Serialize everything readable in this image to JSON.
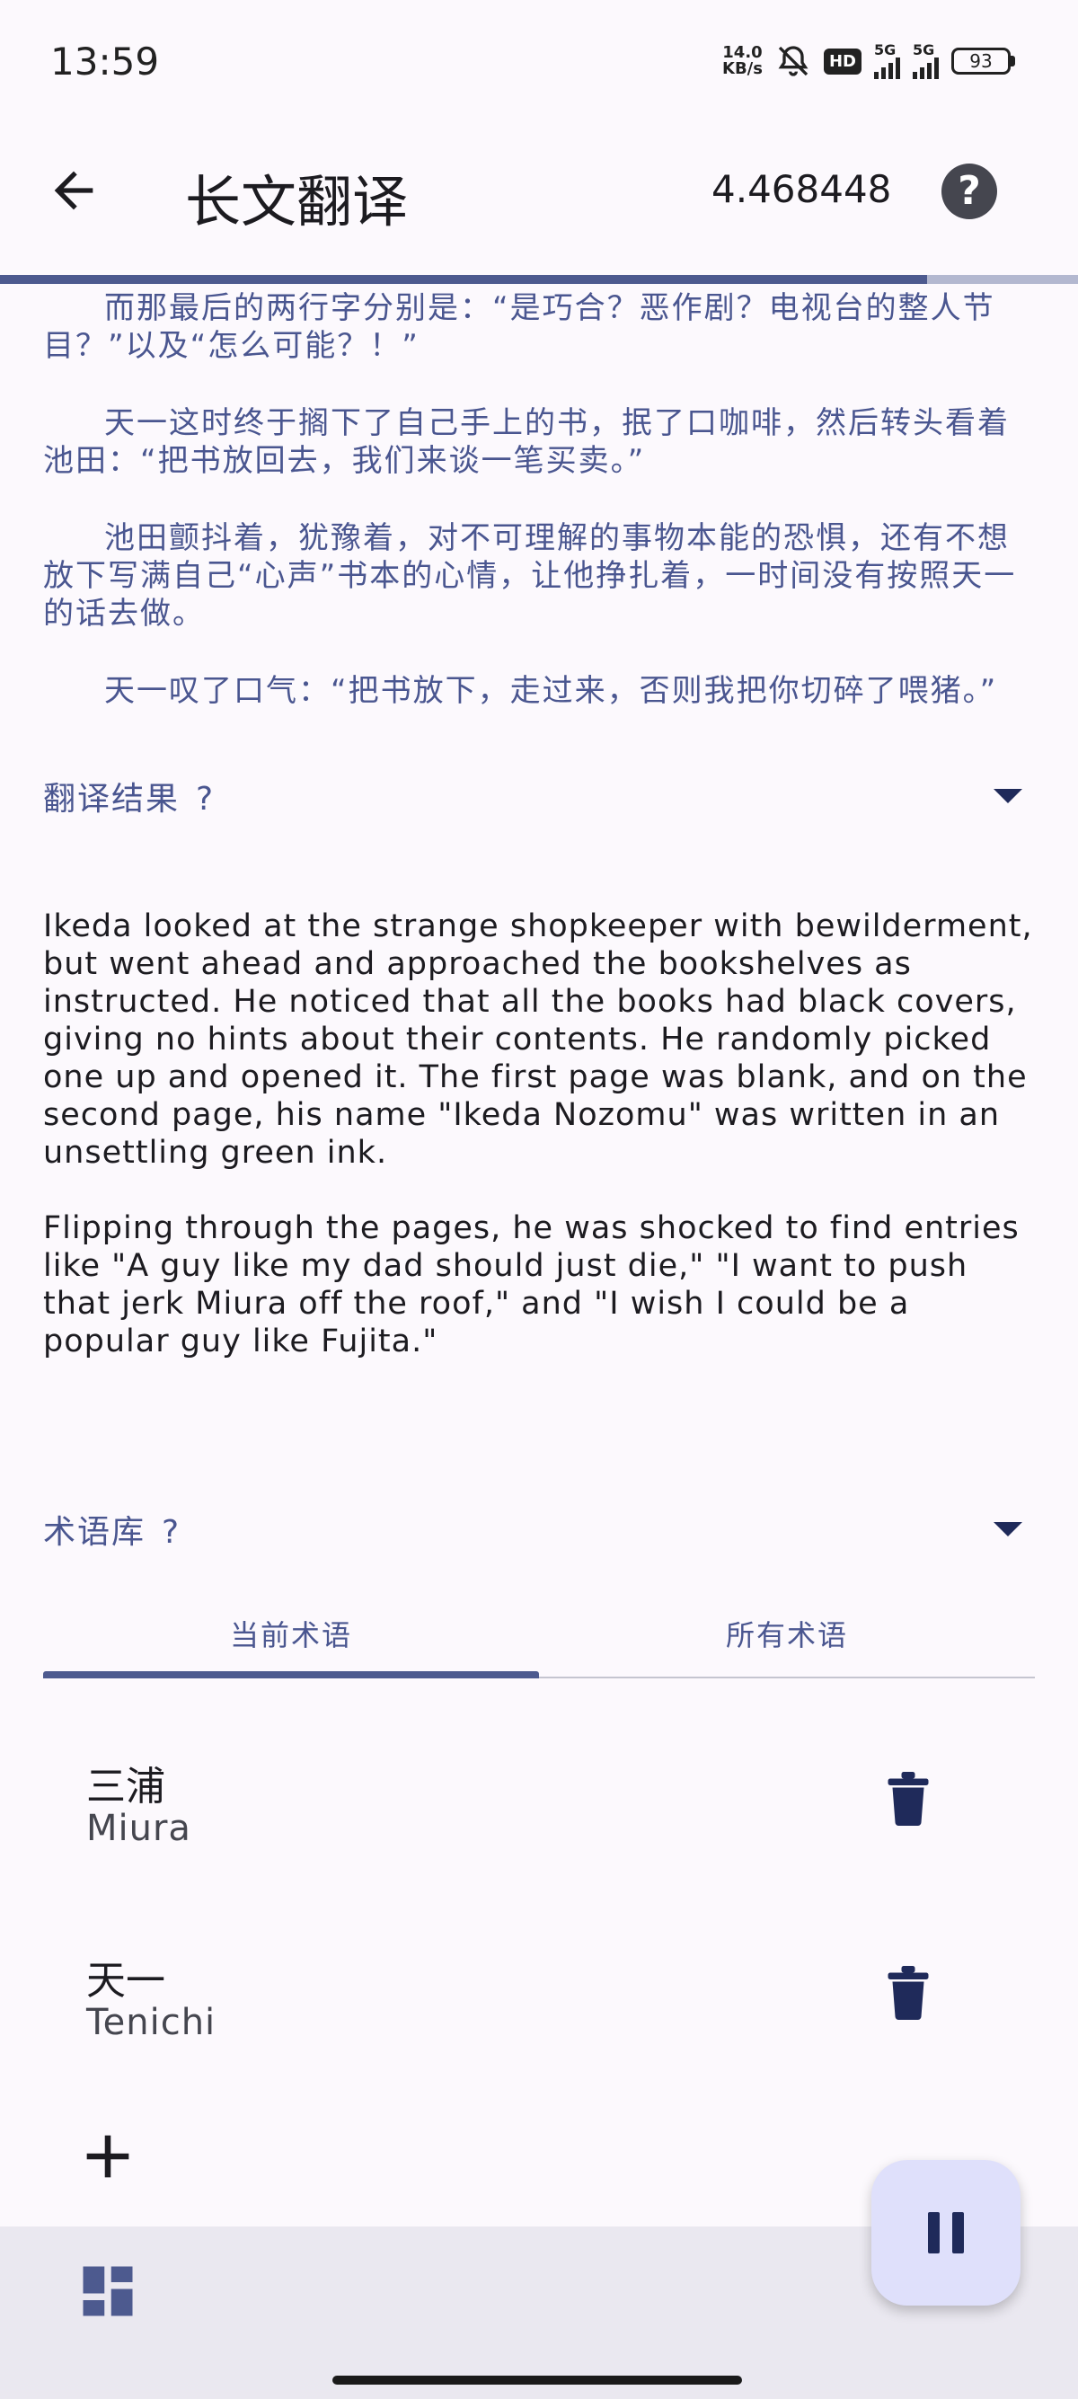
{
  "status_bar": {
    "time": "13:59",
    "net_speed_value": "14.0",
    "net_speed_unit": "KB/s",
    "hd_label": "HD",
    "sim1_label": "5G",
    "sim2_label": "5G",
    "battery": "93"
  },
  "app_bar": {
    "title": "长文翻译",
    "value": "4.468448",
    "help_label": "?"
  },
  "progress": {
    "fraction": 0.86
  },
  "source_text": {
    "paragraphs": [
      "而那最后的两行字分别是：“是巧合？恶作剧？电视台的整人节目？”以及“怎么可能？！”",
      "天一这时终于搁下了自己手上的书，抿了口咖啡，然后转头看着池田：“把书放回去，我们来谈一笔买卖。”",
      "池田颤抖着，犹豫着，对不可理解的事物本能的恐惧，还有不想放下写满自己“心声”书本的心情，让他挣扎着，一时间没有按照天一的话去做。",
      "天一叹了口气：“把书放下，走过来，否则我把你切碎了喂猪。”"
    ]
  },
  "translation_section": {
    "title": "翻译结果",
    "help": "?",
    "paragraphs": [
      "Ikeda looked at the strange shopkeeper with bewilderment, but went ahead and approached the bookshelves as instructed. He noticed that all the books had black covers, giving no hints about their contents. He randomly picked one up and opened it. The first page was blank, and on the second page, his name \"Ikeda Nozomu\" was written in an unsettling green ink.",
      "Flipping through the pages, he was shocked to find entries like \"A guy like my dad should just die,\" \"I want to push that jerk Miura off the roof,\" and \"I wish I could be a popular guy like Fujita.\""
    ]
  },
  "glossary_section": {
    "title": "术语库",
    "help": "?",
    "tabs": [
      "当前术语",
      "所有术语"
    ],
    "terms": [
      {
        "source": "三浦",
        "target": "Miura"
      },
      {
        "source": "天一",
        "target": "Tenichi"
      }
    ]
  },
  "icons": {
    "back": "arrow-left-icon",
    "help": "help-circle-icon",
    "trash": "trash-icon",
    "add": "plus-icon",
    "dashboard": "dashboard-icon",
    "pause": "pause-icon"
  },
  "colors": {
    "accent": "#4d5a8f",
    "text_accent": "#4a5690",
    "fab_bg": "#dfe0fb",
    "bottom_bar": "#eae8f0"
  }
}
